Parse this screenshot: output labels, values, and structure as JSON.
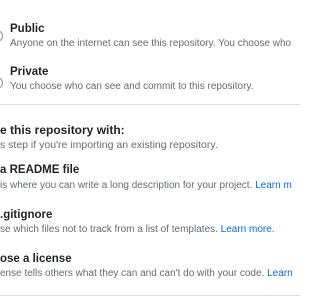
{
  "visibility": {
    "public": {
      "label": "Public",
      "description": "Anyone on the internet can see this repository. You choose who"
    },
    "private": {
      "label": "Private",
      "description": "You choose who can see and commit to this repository."
    }
  },
  "initialize": {
    "heading": "e this repository with:",
    "subtext": "s step if you're importing an existing repository.",
    "readme": {
      "label": "a README file",
      "description": "is where you can write a long description for your project.",
      "link": "Learn m"
    },
    "gitignore": {
      "label": ".gitignore",
      "description": "se which files not to track from a list of templates.",
      "link": "Learn more."
    },
    "license": {
      "label": "ose a license",
      "description": "ense tells others what they can and can't do with your code.",
      "link": "Learn"
    }
  },
  "colors": {
    "text": "#1f2328",
    "muted": "#636c76",
    "link": "#0969da",
    "border": "#d8dee4"
  }
}
